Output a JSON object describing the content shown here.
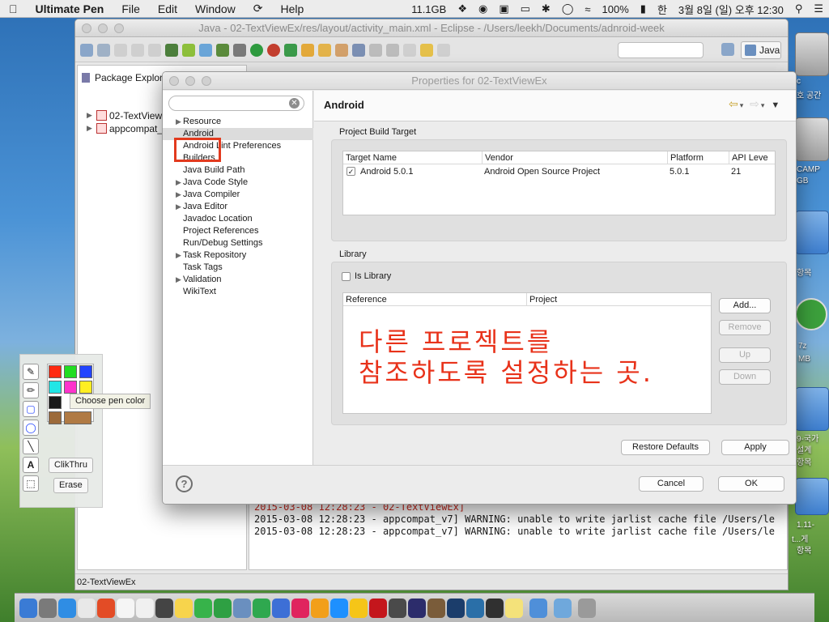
{
  "menubar": {
    "apple": "",
    "app_name": "Ultimate Pen",
    "items": [
      "File",
      "Edit",
      "Window",
      "Help"
    ],
    "memory": "11.1GB",
    "battery": "100%",
    "input_method": "한",
    "datetime": "3월 8일 (일) 오후 12:30"
  },
  "desktop": {
    "right_labels": [
      "c",
      "호 공간",
      "CAMP",
      "GB",
      "항목",
      "7z",
      "MB",
      "9-국가",
      "설계",
      "항목",
      "1.11-",
      "t...게",
      "항목"
    ]
  },
  "eclipse": {
    "title": "Java - 02-TextViewEx/res/layout/activity_main.xml - Eclipse - /Users/leekh/Documents/adnroid-week",
    "perspective": "Java",
    "package_explorer_tab": "Package Explorer",
    "tree": [
      "02-TextViewEx",
      "appcompat_v7"
    ],
    "console_lines": [
      {
        "text": "2015-03-08 12:28:23 - 02-TextViewEx]",
        "color": "#c8281e"
      },
      {
        "text": "2015-03-08 12:28:23 - appcompat_v7] WARNING: unable to write jarlist cache file /Users/le",
        "color": "#1a1a1a"
      },
      {
        "text": "2015-03-08 12:28:23 - appcompat_v7] WARNING: unable to write jarlist cache file /Users/le",
        "color": "#1a1a1a"
      }
    ],
    "status_left": "02-TextViewEx"
  },
  "dialog": {
    "title": "Properties for 02-TextViewEx",
    "filter_placeholder": "",
    "nav": [
      {
        "label": "Resource",
        "expandable": true
      },
      {
        "label": "Android",
        "expandable": false,
        "selected": true
      },
      {
        "label": "Android Lint Preferences",
        "expandable": false
      },
      {
        "label": "Builders",
        "expandable": false
      },
      {
        "label": "Java Build Path",
        "expandable": false
      },
      {
        "label": "Java Code Style",
        "expandable": true
      },
      {
        "label": "Java Compiler",
        "expandable": true
      },
      {
        "label": "Java Editor",
        "expandable": true
      },
      {
        "label": "Javadoc Location",
        "expandable": false
      },
      {
        "label": "Project References",
        "expandable": false
      },
      {
        "label": "Run/Debug Settings",
        "expandable": false
      },
      {
        "label": "Task Repository",
        "expandable": true
      },
      {
        "label": "Task Tags",
        "expandable": false
      },
      {
        "label": "Validation",
        "expandable": true
      },
      {
        "label": "WikiText",
        "expandable": false
      }
    ],
    "page_title": "Android",
    "build_target": {
      "group_label": "Project Build Target",
      "columns": [
        "Target Name",
        "Vendor",
        "Platform",
        "API Leve"
      ],
      "rows": [
        {
          "checked": true,
          "target": "Android 5.0.1",
          "vendor": "Android Open Source Project",
          "platform": "5.0.1",
          "api": "21"
        }
      ]
    },
    "library": {
      "group_label": "Library",
      "is_library_label": "Is Library",
      "is_library_checked": false,
      "columns": [
        "Reference",
        "Project"
      ],
      "buttons": {
        "add": "Add...",
        "remove": "Remove",
        "up": "Up",
        "down": "Down"
      }
    },
    "annotation": [
      "다른 프로젝트를",
      "참조하도록 설정하는 곳."
    ],
    "restore_defaults": "Restore Defaults",
    "apply": "Apply",
    "cancel": "Cancel",
    "ok": "OK",
    "help": "?"
  },
  "pen": {
    "choose_color_tip": "Choose pen color",
    "clikthru": "ClikThru",
    "erase": "Erase",
    "text_tool": "A",
    "swatches": [
      "#ff2a12",
      "#22dd22",
      "#2244ff",
      "#22e6e6",
      "#ff33cc",
      "#ffee22",
      "#1a1a1a",
      "#ffffff",
      "#9c6a3a",
      "#b07a44"
    ]
  },
  "dock": {
    "apps": [
      "Finder",
      "Launchpad",
      "Safari",
      "Photos",
      "Chrome",
      "Calendar",
      "Reminders",
      "Clock",
      "Notes",
      "Messages",
      "FaceTime",
      "Preview",
      "Numbers",
      "Keynote",
      "iTunes",
      "iBooks",
      "App Store",
      "Ultimate Pen",
      "FileZilla",
      "Sublime Text",
      "Eclipse",
      "Quicksilver",
      "Photoshop",
      "Sequel",
      "Terminal",
      "Stickies",
      "Downloads",
      "Documents",
      "Trash"
    ],
    "colors": [
      "#3a7bd5",
      "#7a7a7a",
      "#2f8de4",
      "#e8e8e8",
      "#e34c26",
      "#f5f5f5",
      "#f0f0f0",
      "#444444",
      "#f7d44c",
      "#37b34a",
      "#2ea043",
      "#6a8fbf",
      "#2fa84f",
      "#3d6fd6",
      "#e0245e",
      "#f29f1a",
      "#1e90ff",
      "#f5c518",
      "#c4161c",
      "#4a4a4a",
      "#2c2c6b",
      "#7a5c3a",
      "#1b3d6b",
      "#2a6fa8",
      "#303030",
      "#f4e27a",
      "#4f8fd9",
      "#6fa8dc",
      "#9a9a9a"
    ]
  }
}
